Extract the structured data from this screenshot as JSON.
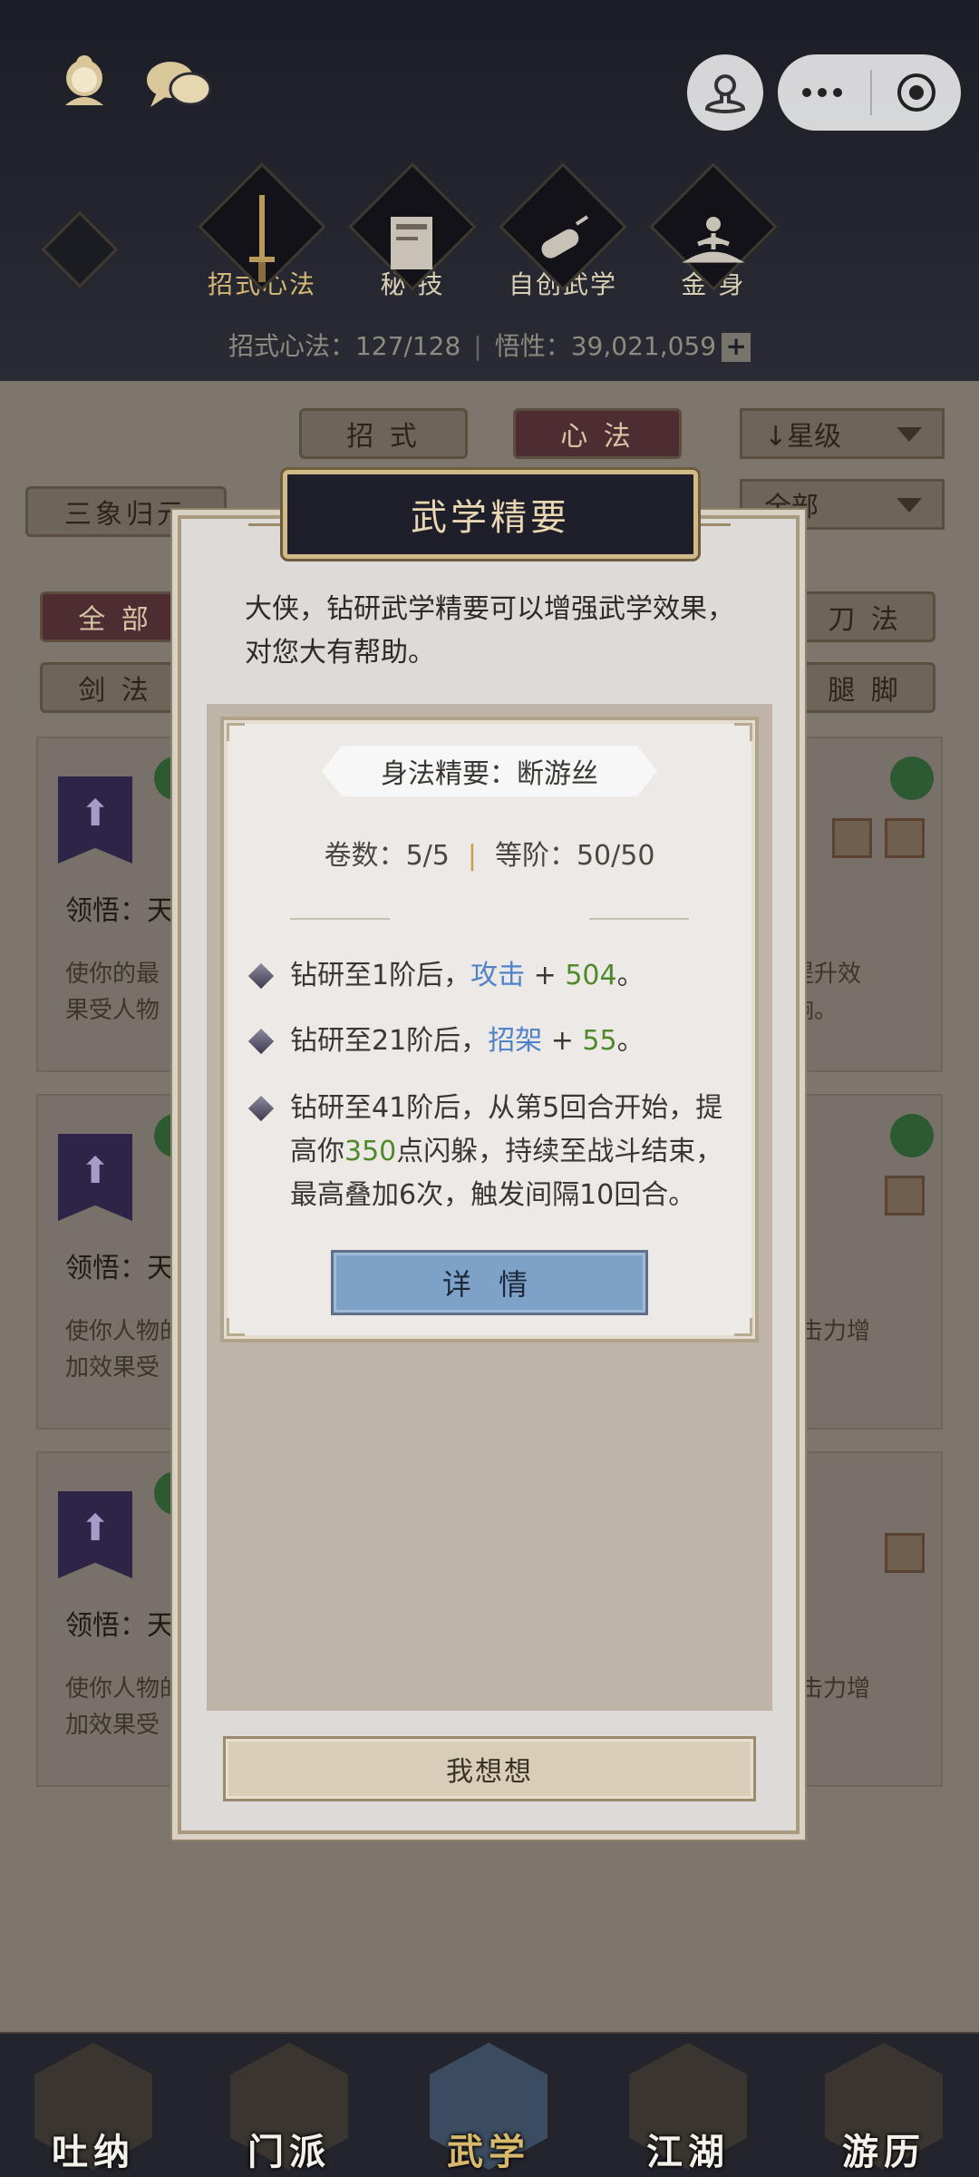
{
  "header": {
    "categories": [
      {
        "label": "招式心法",
        "icon": "sword-icon"
      },
      {
        "label": "秘 技",
        "icon": "book-icon"
      },
      {
        "label": "自创武学",
        "icon": "scroll-icon"
      },
      {
        "label": "金 身",
        "icon": "meditation-icon"
      }
    ],
    "stats_label_1": "招式心法：",
    "stats_value_1": "127/128",
    "stats_label_2": "悟性：",
    "stats_value_2": "39,021,059",
    "plus_label": "+"
  },
  "filters": {
    "tab_moves": "招 式",
    "tab_arts": "心 法",
    "sort_label": "↓星级",
    "left_select": "三象归元",
    "right_select": "全部",
    "all": "全 部",
    "sword": "剑 法",
    "blade": "刀 法",
    "leg": "腿 脚"
  },
  "list": [
    {
      "comprehend": "领悟：天",
      "desc_1": "使你的最",
      "desc_2": "果受人物",
      "right_1": "提升效",
      "right_2": "响。"
    },
    {
      "comprehend": "领悟：天",
      "desc_1": "使你人物的",
      "desc_2": "加效果受",
      "right_1": "击力增",
      "right_2": ""
    },
    {
      "comprehend": "领悟：天",
      "desc_1": "使你人物的",
      "desc_2": "加效果受",
      "right_1": "击力增",
      "right_2": ""
    }
  ],
  "modal": {
    "title": "武学精要",
    "intro": "大侠，钻研武学精要可以增强武学效果，对您大有帮助。",
    "subtitle": "身法精要：断游丝",
    "volume_label": "卷数：",
    "volume_value": "5/5",
    "rank_label": "等阶：",
    "rank_value": "50/50",
    "bonus_1_prefix": "钻研至1阶后，",
    "bonus_1_stat": "攻击",
    "bonus_1_plus": " + ",
    "bonus_1_value": "504",
    "bonus_1_suffix": "。",
    "bonus_2_prefix": "钻研至21阶后，",
    "bonus_2_stat": "招架",
    "bonus_2_plus": " + ",
    "bonus_2_value": "55",
    "bonus_2_suffix": "。",
    "bonus_3_prefix": "钻研至41阶后，从第5回合开始，提高你",
    "bonus_3_value": "350",
    "bonus_3_suffix": "点闪躲，持续至战斗结束，最高叠加6次，触发间隔10回合。",
    "detail_button": "详 情",
    "think_button": "我想想"
  },
  "nav": [
    {
      "label": "吐纳",
      "icon": "breathing-icon"
    },
    {
      "label": "门派",
      "icon": "sect-icon"
    },
    {
      "label": "武学",
      "icon": "martial-book-icon"
    },
    {
      "label": "江湖",
      "icon": "hat-icon"
    },
    {
      "label": "游历",
      "icon": "horse-icon"
    }
  ],
  "colors": {
    "accent_gold": "#d1ba87",
    "stat_blue": "#4f82c9",
    "value_green": "#4e8a2a",
    "detail_button": "#7ea1c8"
  }
}
